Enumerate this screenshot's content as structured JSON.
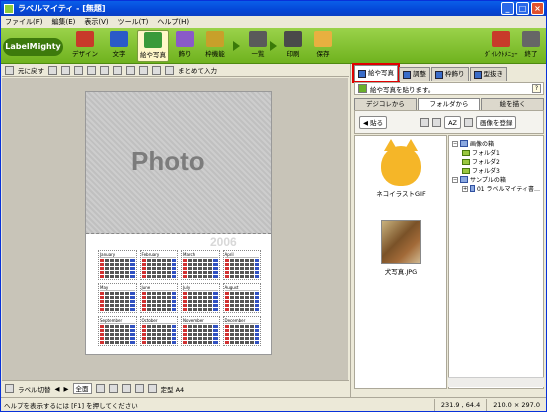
{
  "window": {
    "title": "ラベルマイティ - [無題]",
    "minimize": "_",
    "maximize": "□",
    "close": "×"
  },
  "menu": [
    "ファイル(F)",
    "編集(E)",
    "表示(V)",
    "ツール(T)",
    "ヘルプ(H)"
  ],
  "toolbar": {
    "logo": "LabelMighty",
    "buttons": [
      {
        "label": "デザイン",
        "icon": "design-icon",
        "color": "#c83a2a"
      },
      {
        "label": "文字",
        "icon": "text-icon",
        "color": "#2a5ac8"
      },
      {
        "label": "絵や写真",
        "icon": "picture-icon",
        "color": "#3a9a3a",
        "active": true
      },
      {
        "label": "飾り",
        "icon": "decoration-icon",
        "color": "#8a5ac8"
      },
      {
        "label": "枠機能",
        "icon": "frame-icon",
        "color": "#c8a02a"
      },
      {
        "label": "一覧",
        "icon": "list-icon",
        "color": "#5a5a5a"
      },
      {
        "label": "印刷",
        "icon": "print-icon",
        "color": "#4a4a4a"
      },
      {
        "label": "保存",
        "icon": "save-icon",
        "color": "#e8b040"
      }
    ],
    "right_buttons": [
      {
        "label": "ﾀﾞｲﾚｸﾄﾒﾆｭｰ",
        "icon": "direct-menu-icon"
      },
      {
        "label": "終了",
        "icon": "exit-icon"
      }
    ]
  },
  "edit_toolbar": {
    "undo": "元に戻す",
    "batch_input": "まとめて入力"
  },
  "canvas": {
    "placeholder": "Photo",
    "year": "2006"
  },
  "bottom_bar": {
    "label_switch": "ラベル切替",
    "fit": "全面",
    "size_label": "定型 A4"
  },
  "status": {
    "message": "ヘルプを表示するには [F1] を押してください",
    "coords": "231.9 , 64.4",
    "size": "210.0 × 297.0"
  },
  "right_panel": {
    "tabs": [
      "絵や写真",
      "調整",
      "枠飾り",
      "型抜き"
    ],
    "header": "絵や写真を貼ります。",
    "help": "?",
    "subtabs": [
      "デジコレから",
      "フォルダから",
      "絵を描く"
    ],
    "paste": "貼る",
    "az": "AZ",
    "register": "画像を登録",
    "thumbs": [
      {
        "caption": "ネコイラストGIF",
        "kind": "cat"
      },
      {
        "caption": "犬写真.JPG",
        "kind": "dog"
      }
    ],
    "tree": [
      {
        "label": "画像の箱",
        "level": 0,
        "toggle": "−",
        "type": "box"
      },
      {
        "label": "フォルダ1",
        "level": 1,
        "type": "folder"
      },
      {
        "label": "フォルダ2",
        "level": 1,
        "type": "folder"
      },
      {
        "label": "フォルダ3",
        "level": 1,
        "type": "folder"
      },
      {
        "label": "サンプルの箱",
        "level": 0,
        "toggle": "−",
        "type": "box"
      },
      {
        "label": "01 ラベルマイティ書…",
        "level": 1,
        "toggle": "+",
        "type": "disc"
      }
    ]
  },
  "months": [
    "January",
    "February",
    "March",
    "April",
    "May",
    "June",
    "July",
    "August",
    "September",
    "October",
    "November",
    "December"
  ]
}
